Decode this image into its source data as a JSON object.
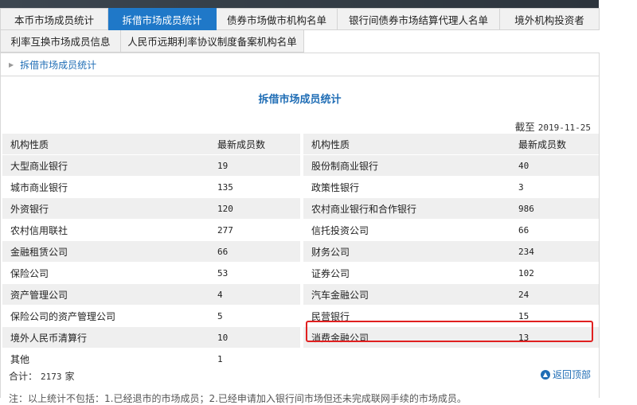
{
  "tabs_row1": [
    "本币市场成员统计",
    "拆借市场成员统计",
    "债券市场做市机构名单",
    "银行间债券市场结算代理人名单",
    "境外机构投资者"
  ],
  "tabs_row2": [
    "利率互换市场成员信息",
    "人民币远期利率协议制度备案机构名单"
  ],
  "breadcrumb": "拆借市场成员统计",
  "title": "拆借市场成员统计",
  "as_of_label": "截至",
  "as_of_date": "2019-11-25",
  "left_header": [
    "机构性质",
    "最新成员数"
  ],
  "right_header": [
    "机构性质",
    "最新成员数"
  ],
  "left_rows": [
    [
      "大型商业银行",
      "19"
    ],
    [
      "城市商业银行",
      "135"
    ],
    [
      "外资银行",
      "120"
    ],
    [
      "农村信用联社",
      "277"
    ],
    [
      "金融租赁公司",
      "66"
    ],
    [
      "保险公司",
      "53"
    ],
    [
      "资产管理公司",
      "4"
    ],
    [
      "保险公司的资产管理公司",
      "5"
    ],
    [
      "境外人民币清算行",
      "10"
    ],
    [
      "其他",
      "1"
    ]
  ],
  "right_rows": [
    [
      "股份制商业银行",
      "40"
    ],
    [
      "政策性银行",
      "3"
    ],
    [
      "农村商业银行和合作银行",
      "986"
    ],
    [
      "信托投资公司",
      "66"
    ],
    [
      "财务公司",
      "234"
    ],
    [
      "证券公司",
      "102"
    ],
    [
      "汽车金融公司",
      "24"
    ],
    [
      "民营银行",
      "15"
    ],
    [
      "消费金融公司",
      "13"
    ]
  ],
  "total_label": "合计：",
  "total_value": "2173",
  "total_unit": "家",
  "back_to_top": "返回顶部",
  "note": "注：以上统计不包括：1.已经退市的市场成员；2.已经申请加入银行间市场但还未完成联网手续的市场成员。",
  "colors": {
    "accent": "#1f78c8",
    "highlight": "#e02020"
  }
}
